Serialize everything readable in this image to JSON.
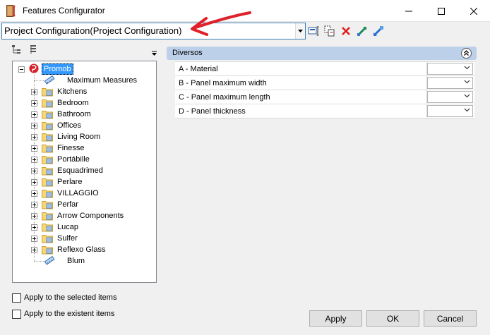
{
  "window": {
    "title": "Features Configurator",
    "app_icon": "features-configurator-icon"
  },
  "config_selector": {
    "value": "Project Configuration(Project Configuration)"
  },
  "toolbar": {
    "icons": [
      "open-config-icon",
      "copy-config-icon",
      "delete-icon",
      "import-icon",
      "export-icon"
    ]
  },
  "tree": {
    "root": {
      "label": "Promob",
      "icon": "promob-logo-icon"
    },
    "items": [
      {
        "label": "Maximum Measures",
        "icon": "ruler-icon",
        "expandable": false
      },
      {
        "label": "Kitchens",
        "icon": "folder-icon",
        "expandable": true
      },
      {
        "label": "Bedroom",
        "icon": "folder-icon",
        "expandable": true
      },
      {
        "label": "Bathroom",
        "icon": "folder-icon",
        "expandable": true
      },
      {
        "label": "Offices",
        "icon": "folder-icon",
        "expandable": true
      },
      {
        "label": "Living Room",
        "icon": "folder-icon",
        "expandable": true
      },
      {
        "label": "Finesse",
        "icon": "folder-icon",
        "expandable": true
      },
      {
        "label": "Portábille",
        "icon": "folder-icon",
        "expandable": true
      },
      {
        "label": "Esquadrimed",
        "icon": "folder-icon",
        "expandable": true
      },
      {
        "label": "Perlare",
        "icon": "folder-icon",
        "expandable": true
      },
      {
        "label": "VILLAGGIO",
        "icon": "folder-icon",
        "expandable": true
      },
      {
        "label": "Perfar",
        "icon": "folder-icon",
        "expandable": true
      },
      {
        "label": "Arrow Components",
        "icon": "folder-icon",
        "expandable": true
      },
      {
        "label": "Lucap",
        "icon": "folder-icon",
        "expandable": true
      },
      {
        "label": "Sulfer",
        "icon": "folder-icon",
        "expandable": true
      },
      {
        "label": "Reflexo Glass",
        "icon": "folder-icon",
        "expandable": true
      },
      {
        "label": "Blum",
        "icon": "ruler-icon",
        "expandable": false
      }
    ]
  },
  "options": {
    "apply_selected": "Apply to the selected items",
    "apply_existent": "Apply to the existent items"
  },
  "group": {
    "title": "Diversos",
    "properties": [
      {
        "label": "A - Material",
        "value": ""
      },
      {
        "label": "B - Panel maximum width",
        "value": ""
      },
      {
        "label": "C - Panel maximum length",
        "value": ""
      },
      {
        "label": "D - Panel thickness",
        "value": ""
      }
    ]
  },
  "buttons": {
    "apply": "Apply",
    "ok": "OK",
    "cancel": "Cancel"
  },
  "colors": {
    "selection": "#3399ff",
    "group_header": "#bcd0e9",
    "annotation_arrow": "#e0202a"
  }
}
